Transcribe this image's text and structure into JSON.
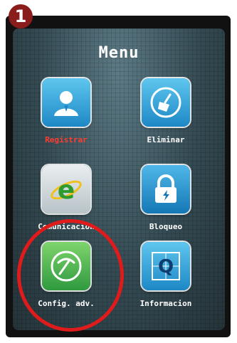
{
  "step_badge": "1",
  "menu": {
    "title": "Menu",
    "items": [
      {
        "label": "Registrar",
        "icon": "user-icon",
        "selected": true
      },
      {
        "label": "Eliminar",
        "icon": "broom-icon",
        "selected": false
      },
      {
        "label": "Comunicacion",
        "icon": "internet-explorer-icon",
        "selected": false
      },
      {
        "label": "Bloqueo",
        "icon": "lock-icon",
        "selected": false
      },
      {
        "label": "Config. adv.",
        "icon": "pickaxe-icon",
        "selected": false
      },
      {
        "label": "Informacion",
        "icon": "info-q-icon",
        "selected": false
      }
    ]
  },
  "colors": {
    "badge": "#8a1c1c",
    "selected_label": "#ff3b2f",
    "highlight_ring": "#e01b1b"
  }
}
